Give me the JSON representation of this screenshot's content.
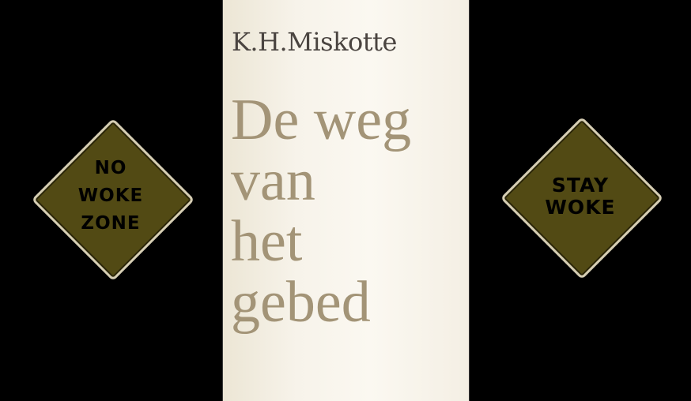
{
  "left_sign": {
    "lines": [
      "NO",
      "WOKE",
      "ZONE"
    ]
  },
  "right_sign": {
    "lines": [
      "STAY",
      "WOKE"
    ]
  },
  "book": {
    "author": "K.H.Miskotte",
    "title_lines": [
      "De weg",
      "van",
      "het",
      "gebed"
    ]
  }
}
